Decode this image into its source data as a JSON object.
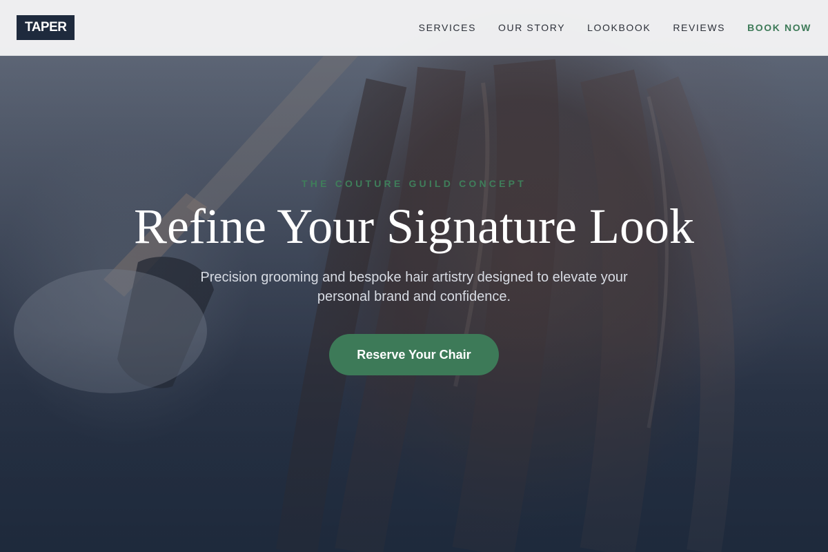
{
  "brand": {
    "logo_text": "TAPER"
  },
  "nav": {
    "items": [
      {
        "label": "SERVICES"
      },
      {
        "label": "OUR STORY"
      },
      {
        "label": "LOOKBOOK"
      },
      {
        "label": "REVIEWS"
      }
    ],
    "cta_label": "BOOK NOW"
  },
  "hero": {
    "eyebrow": "THE COUTURE GUILD CONCEPT",
    "headline": "Refine Your Signature Look",
    "subtext": "Precision grooming and bespoke hair artistry designed to elevate your personal brand and confidence.",
    "button_label": "Reserve Your Chair"
  },
  "colors": {
    "accent": "#3d7a58",
    "logo_bg": "#1e2a3d",
    "header_bg": "#f4f4f5"
  }
}
